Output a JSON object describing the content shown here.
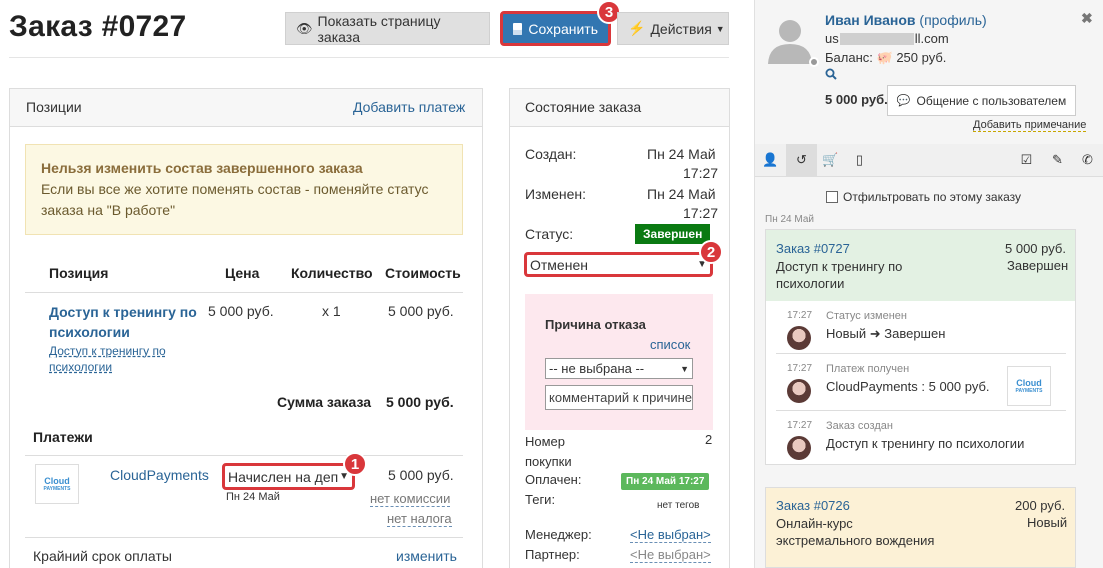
{
  "header": {
    "title": "Заказ #0727",
    "show_order_page": "Показать страницу заказа",
    "save": "Сохранить",
    "actions": "Действия",
    "callouts": [
      "1",
      "2",
      "3"
    ]
  },
  "positions_panel": {
    "title": "Позиции",
    "add_payment": "Добавить платеж",
    "warning_title": "Нельзя изменить состав завершенного заказа",
    "warning_text": "Если вы все же хотите поменять состав - поменяйте статус заказа на \"В работе\"",
    "columns": [
      "Позиция",
      "Цена",
      "Количество",
      "Стоимость"
    ],
    "item": {
      "name": "Доступ к тренингу по психологии",
      "sublink": "Доступ к тренингу по психологии",
      "price": "5 000 руб.",
      "qty": "x 1",
      "cost": "5 000 руб."
    },
    "total_label": "Сумма заказа",
    "total_value": "5 000 руб.",
    "payments_title": "Платежи",
    "payment": {
      "provider": "CloudPayments",
      "logo_text": "Cloud",
      "logo_sub": "PAYMENTS",
      "status_select": "Начислен на деп",
      "date": "Пн 24 Май",
      "amount": "5 000 руб.",
      "commission": "нет комиссии",
      "tax": "нет налога"
    },
    "deadline_label": "Крайний срок оплаты",
    "deadline_change": "изменить"
  },
  "state_panel": {
    "title": "Состояние заказа",
    "created_label": "Создан:",
    "created_value": "Пн 24 Май",
    "created_time": "17:27",
    "changed_label": "Изменен:",
    "changed_value": "Пн 24 Май",
    "changed_time": "17:27",
    "status_label": "Статус:",
    "status_value": "Завершен",
    "status_select": "Отменен",
    "reason_title": "Причина отказа",
    "reason_list": "список",
    "reason_select": "-- не выбрана --",
    "reason_comment_placeholder": "комментарий к причине",
    "purchase_label_1": "Номер",
    "purchase_label_2": "покупки",
    "purchase_value": "2",
    "paid_label": "Оплачен:",
    "paid_value": "Пн 24 Май 17:27",
    "tags_label": "Теги:",
    "tags_value": "нет тегов",
    "manager_label": "Менеджер:",
    "manager_value": "<Не выбран>",
    "partner_label": "Партнер:",
    "partner_value": "<Не выбран>"
  },
  "user": {
    "name": "Иван Иванов",
    "profile": "(профиль)",
    "email_prefix": "us",
    "email_suffix": "ll.com",
    "balance_label": "Баланс:",
    "balance_value": "250 руб.",
    "total": "5 000 руб.",
    "chat_button": "Общение с пользователем",
    "add_note": "Добавить примечание",
    "filter_label": "Отфильтровать по этому заказу",
    "date_group": "Пн 24 Май"
  },
  "orders": [
    {
      "id": "Заказ #0727",
      "amount": "5 000 руб.",
      "title": "Доступ к тренингу по психологии",
      "status": "Завершен",
      "events": [
        {
          "time": "17:27",
          "title": "Статус изменен",
          "text": "Новый ➜ Завершен"
        },
        {
          "time": "17:27",
          "title": "Платеж получен",
          "text": "CloudPayments : 5 000 руб."
        },
        {
          "time": "17:27",
          "title": "Заказ создан",
          "text": "Доступ к тренингу по психологии"
        }
      ]
    },
    {
      "id": "Заказ #0726",
      "amount": "200 руб.",
      "title": "Онлайн-курс экстремального вождения",
      "status": "Новый"
    }
  ],
  "colors": {
    "save": "#3276b1",
    "callout": "#d9373b",
    "status_done": "#0a7a12",
    "paid": "#5cb85c"
  }
}
